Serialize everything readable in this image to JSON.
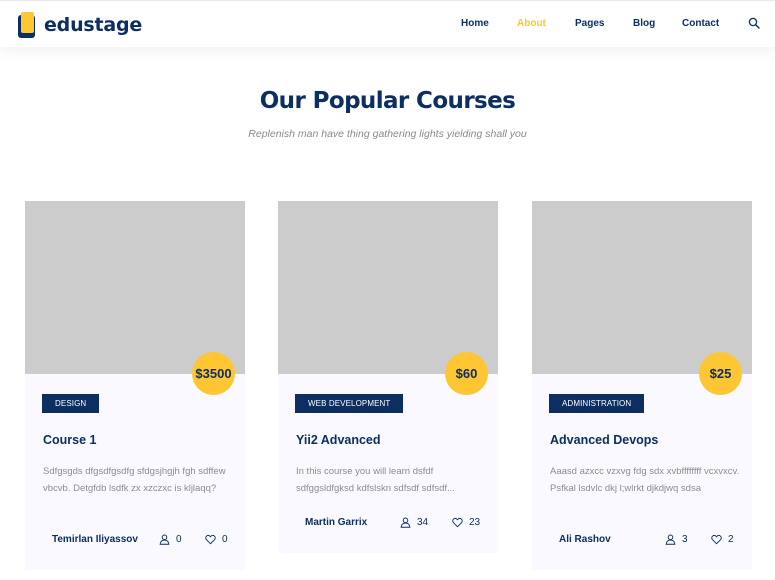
{
  "header": {
    "logo_text": "edustage",
    "nav": [
      "Home",
      "About",
      "Pages",
      "Blog",
      "Contact"
    ],
    "active_nav": "About",
    "search_icon": "search-icon"
  },
  "section": {
    "title": "Our Popular Courses",
    "subtitle": "Replenish man have thing gathering lights yielding shall you"
  },
  "courses": [
    {
      "price": "$3500",
      "category": "DESIGN",
      "title": "Course 1",
      "description": "Sdfgsgds dfgsdfgsdfg sfdgsjhgjh fgh sdffew vbcvb. Detgfdb lsdfk zx xzczxc is kljlaqq?",
      "author": "Temirlan Iliyassov",
      "students": "0",
      "likes": "0"
    },
    {
      "price": "$60",
      "category": "WEB DEVELOPMENT",
      "title": "Yii2 Advanced",
      "description": "In this course you will learn dsfdf sdfggsldfgksd kdfslskn sdfsdf sdfsdf...",
      "author": "Martin Garrix",
      "students": "34",
      "likes": "23"
    },
    {
      "price": "$25",
      "category": "ADMINISTRATION",
      "title": "Advanced Devops",
      "description": "Aaasd azxcc vzxvg fdg sdx xvbffffffff vcxvxcv. Psfkal lsdvlc dkj l;wlrkt djkdjwq sdsa",
      "author": "Ali Rashov",
      "students": "3",
      "likes": "2"
    }
  ],
  "colors": {
    "navy": "#0c2e60",
    "yellow": "#fdc632",
    "card_bg": "#f9f9ff",
    "thumb_bg": "#cccccc"
  },
  "icons": {
    "students": "user-icon",
    "likes": "heart-icon"
  }
}
